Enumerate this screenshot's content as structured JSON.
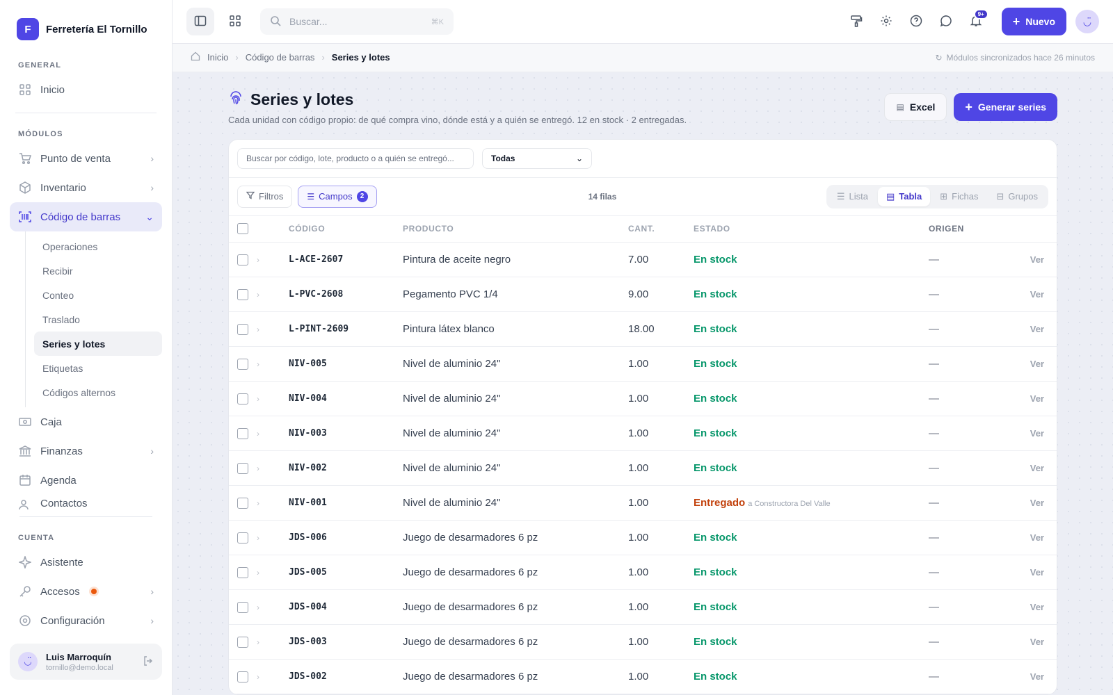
{
  "brand": {
    "initial": "F",
    "name": "Ferretería El Tornillo"
  },
  "sidebar": {
    "general_label": "GENERAL",
    "home_label": "Inicio",
    "modules_label": "MÓDULOS",
    "modules": [
      {
        "label": "Punto de venta",
        "icon": "cart-icon"
      },
      {
        "label": "Inventario",
        "icon": "box-icon"
      },
      {
        "label": "Código de barras",
        "icon": "barcode-icon"
      }
    ],
    "barcode_sub": [
      "Operaciones",
      "Recibir",
      "Conteo",
      "Traslado",
      "Series y lotes",
      "Etiquetas",
      "Códigos alternos"
    ],
    "more_modules": [
      {
        "label": "Caja",
        "icon": "cash-icon"
      },
      {
        "label": "Finanzas",
        "icon": "bank-icon"
      },
      {
        "label": "Agenda",
        "icon": "calendar-icon"
      },
      {
        "label": "Contactos",
        "icon": "contacts-icon"
      }
    ],
    "account_label": "CUENTA",
    "account_items": [
      {
        "label": "Asistente",
        "icon": "sparkle-icon"
      },
      {
        "label": "Accesos",
        "icon": "key-icon"
      },
      {
        "label": "Configuración",
        "icon": "gear-icon"
      }
    ],
    "user": {
      "name": "Luis Marroquín",
      "email": "tornillo@demo.local"
    }
  },
  "topbar": {
    "search_placeholder": "Buscar...",
    "search_shortcut": "⌘K",
    "notif_count": "9+",
    "new_label": "Nuevo"
  },
  "breadcrumb": {
    "home": "Inicio",
    "parent": "Código de barras",
    "current": "Series y lotes",
    "sync": "Módulos sincronizados hace 26 minutos"
  },
  "page": {
    "title": "Series y lotes",
    "subtitle": "Cada unidad con código propio: de qué compra vino, dónde está y a quién se entregó. 12 en stock · 2 entregadas.",
    "excel_label": "Excel",
    "generate_label": "Generar series"
  },
  "filters": {
    "search_placeholder": "Buscar por código, lote, producto o a quién se entregó...",
    "status_value": "Todas",
    "filters_label": "Filtros",
    "fields_label": "Campos",
    "fields_count": "2",
    "row_count": "14 filas",
    "views": [
      "Lista",
      "Tabla",
      "Fichas",
      "Grupos"
    ]
  },
  "table": {
    "headers": {
      "code": "CÓDIGO",
      "product": "PRODUCTO",
      "qty": "CANT.",
      "state": "ESTADO",
      "origin": "ORIGEN"
    },
    "action_label": "Ver",
    "rows": [
      {
        "code": "L-ACE-2607",
        "product": "Pintura de aceite negro",
        "qty": "7.00",
        "state": "En stock",
        "note": "",
        "origin": "—"
      },
      {
        "code": "L-PVC-2608",
        "product": "Pegamento PVC 1/4",
        "qty": "9.00",
        "state": "En stock",
        "note": "",
        "origin": "—"
      },
      {
        "code": "L-PINT-2609",
        "product": "Pintura látex blanco",
        "qty": "18.00",
        "state": "En stock",
        "note": "",
        "origin": "—"
      },
      {
        "code": "NIV-005",
        "product": "Nivel de aluminio 24\"",
        "qty": "1.00",
        "state": "En stock",
        "note": "",
        "origin": "—"
      },
      {
        "code": "NIV-004",
        "product": "Nivel de aluminio 24\"",
        "qty": "1.00",
        "state": "En stock",
        "note": "",
        "origin": "—"
      },
      {
        "code": "NIV-003",
        "product": "Nivel de aluminio 24\"",
        "qty": "1.00",
        "state": "En stock",
        "note": "",
        "origin": "—"
      },
      {
        "code": "NIV-002",
        "product": "Nivel de aluminio 24\"",
        "qty": "1.00",
        "state": "En stock",
        "note": "",
        "origin": "—"
      },
      {
        "code": "NIV-001",
        "product": "Nivel de aluminio 24\"",
        "qty": "1.00",
        "state": "Entregado",
        "note": "a Constructora Del Valle",
        "origin": "—"
      },
      {
        "code": "JDS-006",
        "product": "Juego de desarmadores 6 pz",
        "qty": "1.00",
        "state": "En stock",
        "note": "",
        "origin": "—"
      },
      {
        "code": "JDS-005",
        "product": "Juego de desarmadores 6 pz",
        "qty": "1.00",
        "state": "En stock",
        "note": "",
        "origin": "—"
      },
      {
        "code": "JDS-004",
        "product": "Juego de desarmadores 6 pz",
        "qty": "1.00",
        "state": "En stock",
        "note": "",
        "origin": "—"
      },
      {
        "code": "JDS-003",
        "product": "Juego de desarmadores 6 pz",
        "qty": "1.00",
        "state": "En stock",
        "note": "",
        "origin": "—"
      },
      {
        "code": "JDS-002",
        "product": "Juego de desarmadores 6 pz",
        "qty": "1.00",
        "state": "En stock",
        "note": "",
        "origin": "—"
      }
    ]
  },
  "colors": {
    "accent": "#4f46e5",
    "in_stock": "#059669",
    "delivered": "#c2410c"
  }
}
